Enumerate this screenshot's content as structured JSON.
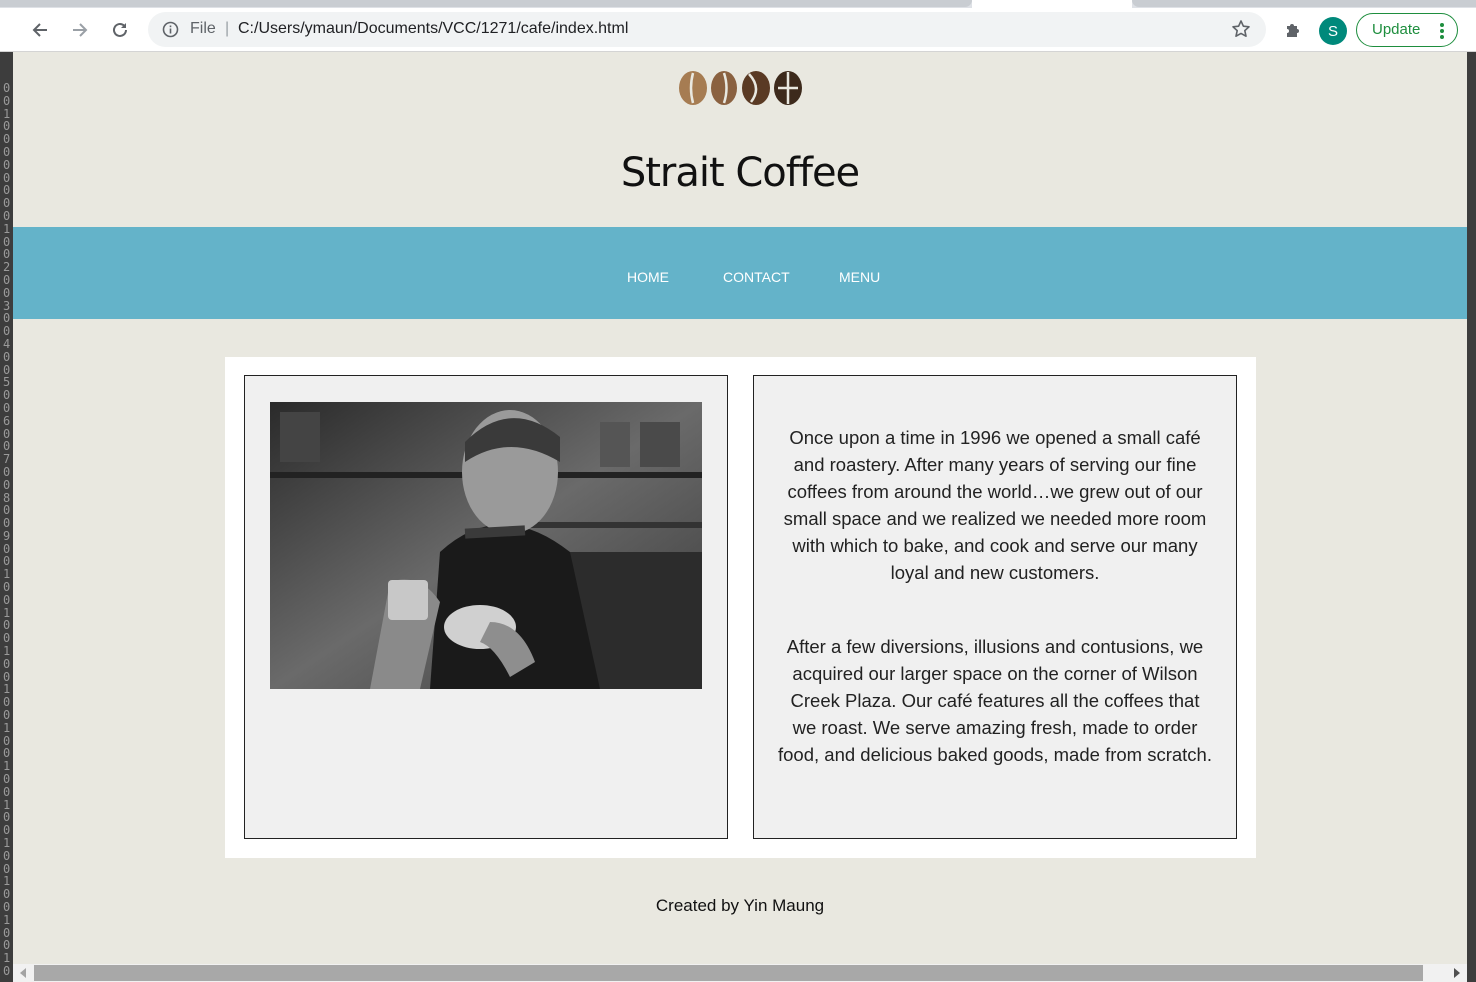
{
  "browser": {
    "back_icon": "arrow-left-icon",
    "forward_icon": "arrow-right-icon",
    "reload_icon": "reload-icon",
    "address": {
      "scheme_label": "File",
      "separator": "|",
      "url": "C:/Users/ymaun/Documents/VCC/1271/cafe/index.html"
    },
    "bookmark_icon": "star-icon",
    "extensions_icon": "puzzle-piece-icon",
    "profile_initial": "S",
    "update_label": "Update",
    "menu_icon": "kebab-menu-icon"
  },
  "site": {
    "logo_colors": [
      "#a67c52",
      "#8a6140",
      "#5a3a24",
      "#3d2a1c"
    ],
    "title": "Strait Coffee",
    "nav": [
      {
        "label": "HOME"
      },
      {
        "label": "CONTACT"
      },
      {
        "label": "MENU"
      }
    ],
    "story": [
      "Once upon a time in 1996 we opened a small café and roastery. After many years of serving our fine coffees from around the world…we grew out of our small space and we realized we needed more room with which to bake, and cook and serve our many loyal and new customers.",
      "After a few diversions, illusions and contusions, we acquired our larger space on the corner of Wilson Creek Plaza. Our café features all the coffees that we roast. We serve amazing fresh, made to order food, and delicious baked goods, made from scratch."
    ],
    "footer": "Created by Yin Maung"
  },
  "colors": {
    "page_bg": "#e9e8e0",
    "nav_bg": "#64b3c9",
    "panel_bg": "#f0f0f0"
  }
}
